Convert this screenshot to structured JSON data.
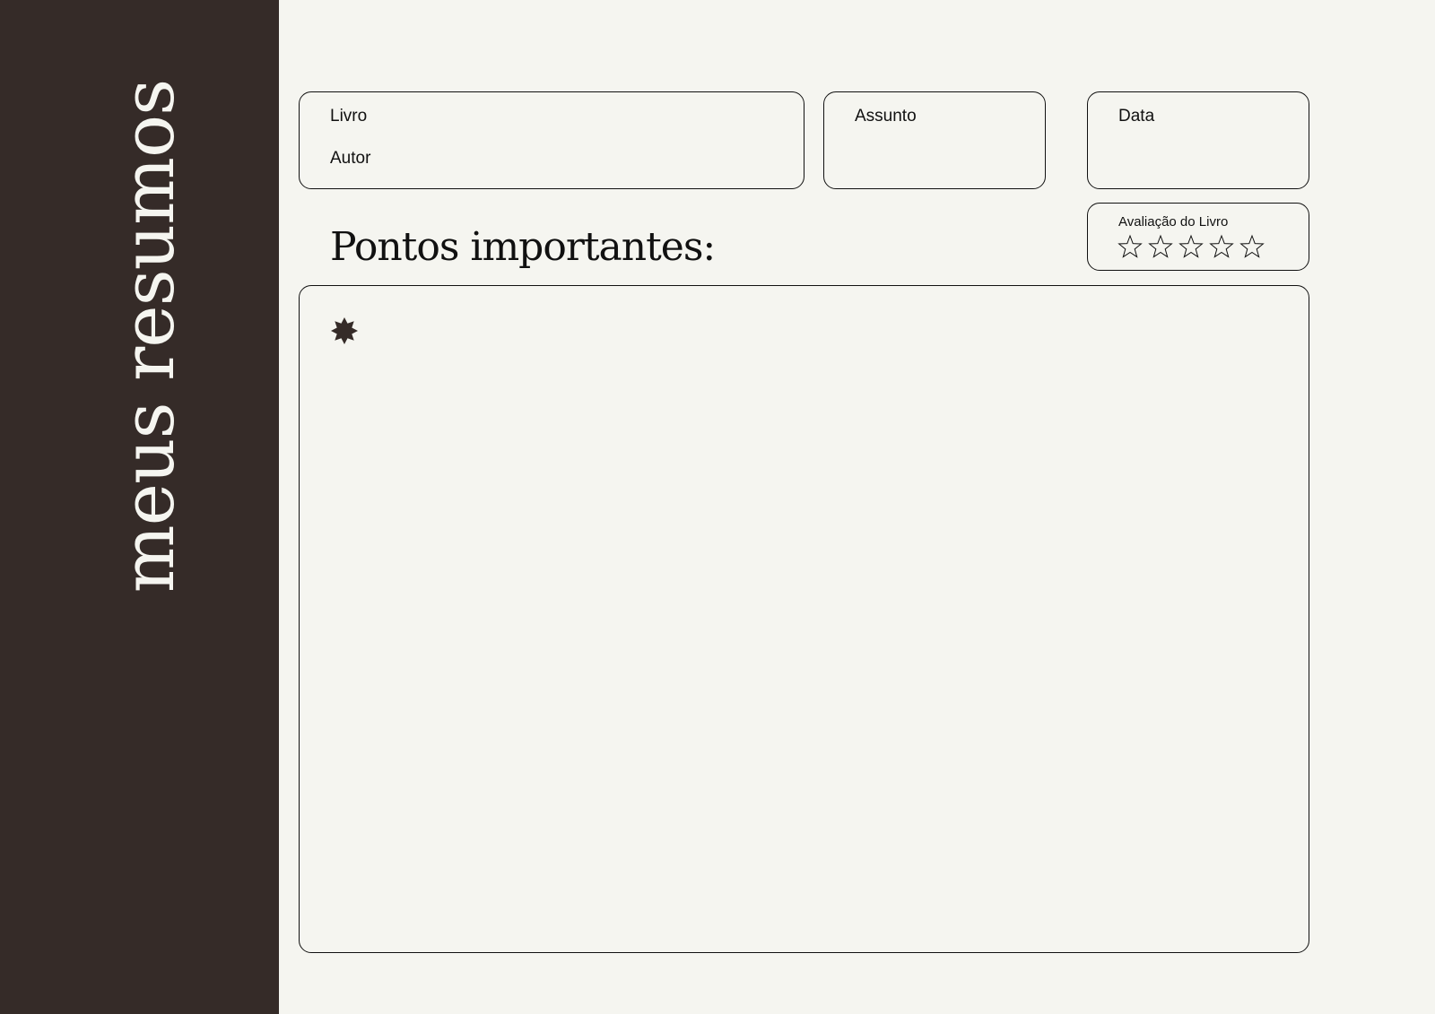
{
  "sidebar": {
    "title": "meus resumos"
  },
  "header": {
    "book_label": "Livro",
    "author_label": "Autor",
    "subject_label": "Assunto",
    "date_label": "Data"
  },
  "rating": {
    "label": "Avaliação do Livro",
    "max_stars": 5,
    "value": 0,
    "icon": "star-outline-icon"
  },
  "main": {
    "section_title": "Pontos importantes:",
    "bullet_icon": "star-bullet-icon"
  },
  "colors": {
    "sidebar_bg": "#352b28",
    "page_bg": "#f5f5f0",
    "text": "#111111"
  }
}
